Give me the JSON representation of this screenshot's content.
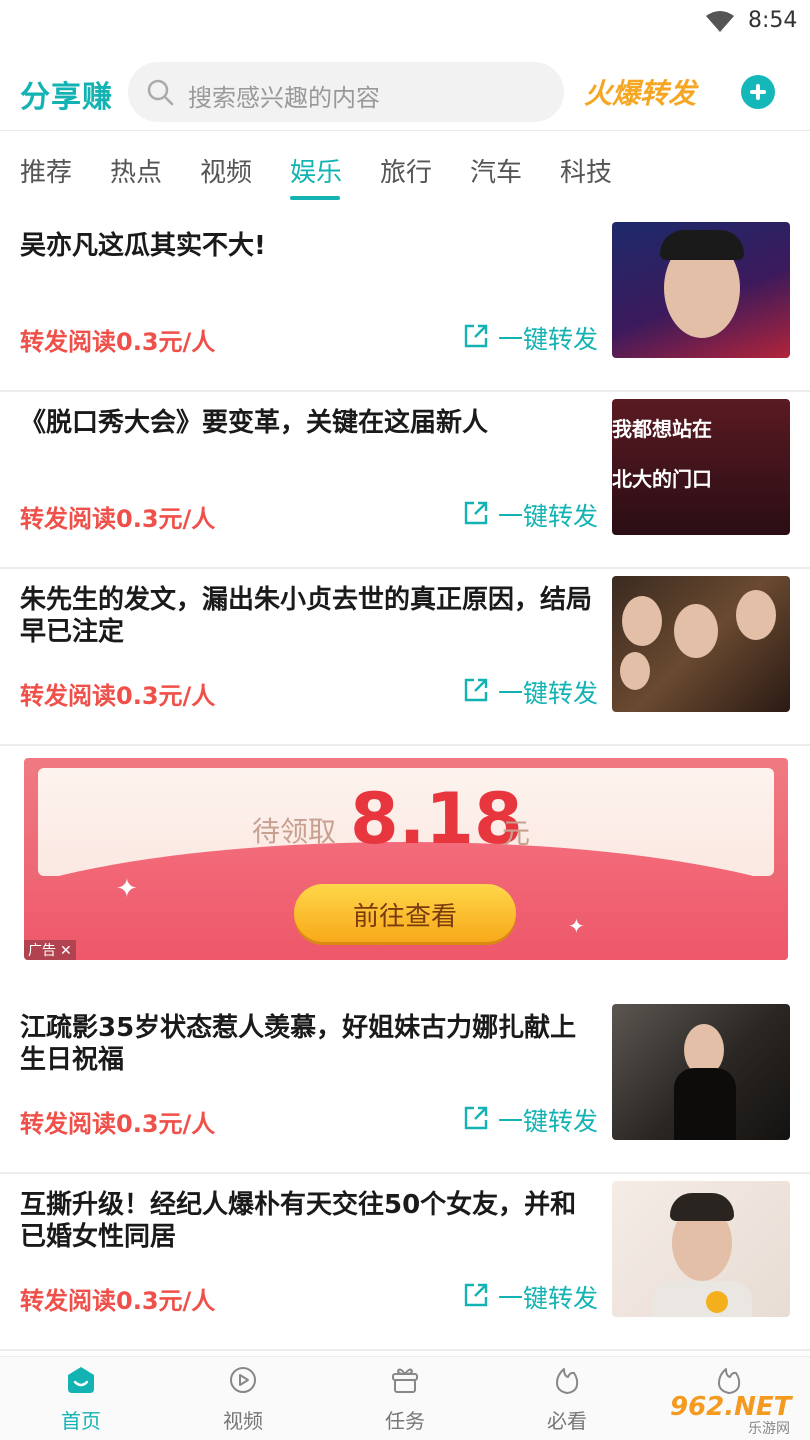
{
  "status_bar": {
    "time": "8:54"
  },
  "header": {
    "logo": "分享赚",
    "search_placeholder": "搜索感兴趣的内容",
    "hot_button": "火爆转发"
  },
  "tabs": [
    {
      "label": "推荐",
      "active": false
    },
    {
      "label": "热点",
      "active": false
    },
    {
      "label": "视频",
      "active": false
    },
    {
      "label": "娱乐",
      "active": true
    },
    {
      "label": "旅行",
      "active": false
    },
    {
      "label": "汽车",
      "active": false
    },
    {
      "label": "科技",
      "active": false
    }
  ],
  "news": [
    {
      "title": "吴亦凡这瓜其实不大!",
      "reward": "转发阅读0.3元/人",
      "share": "一键转发"
    },
    {
      "title": "《脱口秀大会》要变革，关键在这届新人",
      "reward": "转发阅读0.3元/人",
      "share": "一键转发",
      "thumb_text": [
        "我都想站在",
        "北大的门口"
      ]
    },
    {
      "title": "朱先生的发文，漏出朱小贞去世的真正原因，结局早已注定",
      "reward": "转发阅读0.3元/人",
      "share": "一键转发"
    },
    {
      "title": "江疏影35岁状态惹人羡慕，好姐妹古力娜扎献上生日祝福",
      "reward": "转发阅读0.3元/人",
      "share": "一键转发"
    },
    {
      "title": "互撕升级！经纪人爆朴有天交往50个女友，并和已婚女性同居",
      "reward": "转发阅读0.3元/人",
      "share": "一键转发"
    }
  ],
  "ad": {
    "pending_label": "待领取",
    "amount": "8.18",
    "unit": "元",
    "cta": "前往查看",
    "tag": "广告"
  },
  "bottom_nav": [
    {
      "label": "首页",
      "icon": "home-icon",
      "active": true
    },
    {
      "label": "视频",
      "icon": "play-icon",
      "active": false
    },
    {
      "label": "任务",
      "icon": "gift-icon",
      "active": false
    },
    {
      "label": "必看",
      "icon": "fire-icon",
      "active": false
    },
    {
      "label": "",
      "icon": "hot-icon",
      "active": false
    }
  ],
  "watermark": {
    "brand": "962.NET",
    "sub": "乐游网"
  },
  "colors": {
    "accent": "#14b3b3",
    "reward": "#f0504a",
    "hot": "#f5a623"
  }
}
